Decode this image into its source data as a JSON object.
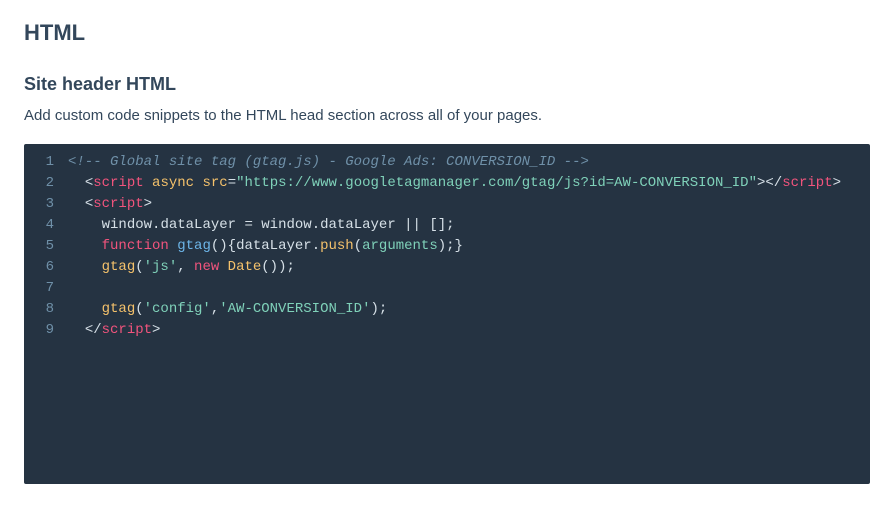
{
  "page_title": "HTML",
  "section": {
    "title": "Site header HTML",
    "description": "Add custom code snippets to the HTML head section across all of your pages."
  },
  "editor": {
    "lines": [
      {
        "n": "1"
      },
      {
        "n": "2"
      },
      {
        "n": "3"
      },
      {
        "n": "4"
      },
      {
        "n": "5"
      },
      {
        "n": "6"
      },
      {
        "n": "7"
      },
      {
        "n": "8"
      },
      {
        "n": "9"
      }
    ],
    "tokens": {
      "comment": "<!-- Global site tag (gtag.js) - Google Ads: CONVERSION_ID -->",
      "script_open": "script",
      "async_attr": "async",
      "src_attr": "src",
      "src_val": "\"https://www.googletagmanager.com/gtag/js?id=AW-CONVERSION_ID\"",
      "window": "window",
      "dataLayer": "dataLayer",
      "or_empty": " || [];",
      "function_kw": "function",
      "gtag_name": "gtag",
      "push": "push",
      "arguments": "arguments",
      "js_str": "'js'",
      "new_kw": "new",
      "Date": "Date",
      "config_str": "'config'",
      "conv_id_str": "'AW-CONVERSION_ID'",
      "lt": "<",
      "gt": ">",
      "lts": "</",
      "eq": "=",
      "dot": ".",
      "assign": " = ",
      "open_paren": "(",
      "close_paren": ")",
      "open_brace": "{",
      "close_brace": "}",
      "semi": ";",
      "comma": ",",
      "space": " ",
      "empty_par": "()",
      "empty_par_semi": "());",
      "close_par_semi": ");",
      "close_brace_semi": ";}"
    }
  }
}
